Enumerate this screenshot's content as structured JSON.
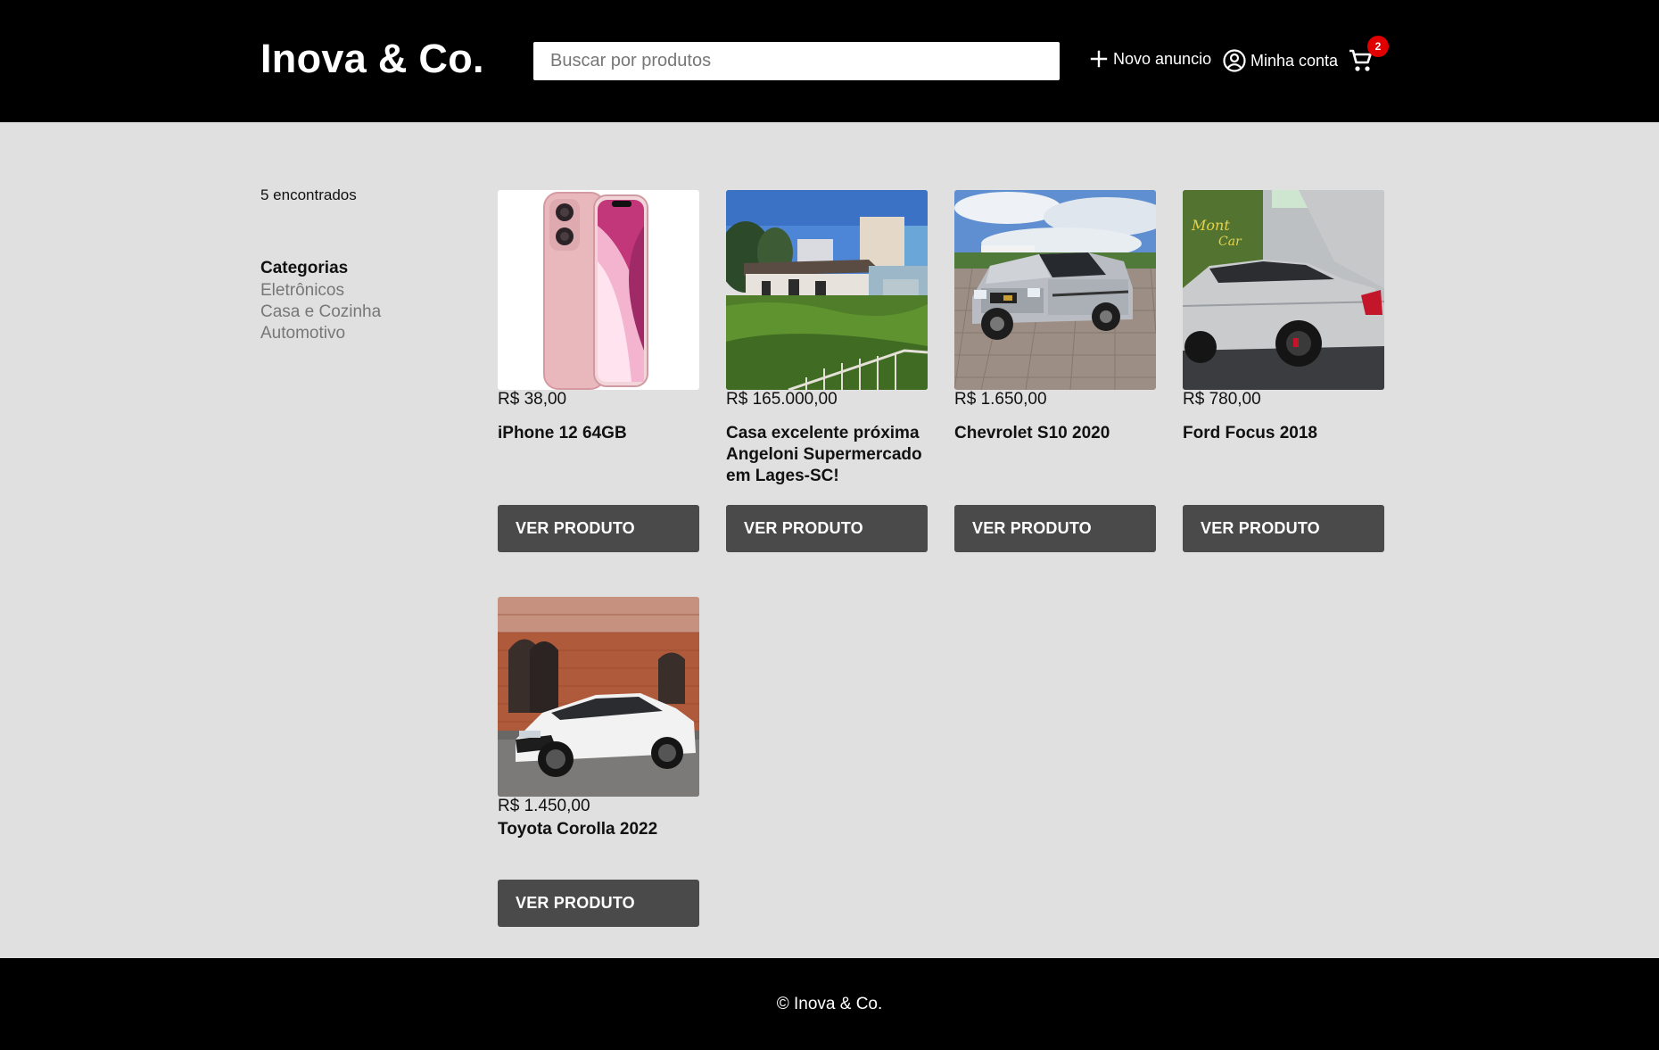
{
  "header": {
    "logo": "Inova & Co.",
    "search_placeholder": "Buscar por produtos",
    "new_listing_label": "Novo anuncio",
    "account_label": "Minha conta",
    "cart_count": "2"
  },
  "sidebar": {
    "results_count": "5 encontrados",
    "categories_title": "Categorias",
    "categories": [
      "Eletrônicos",
      "Casa e Cozinha",
      "Automotivo"
    ]
  },
  "products": [
    {
      "price": "R$ 38,00",
      "name": "iPhone 12 64GB",
      "button": "VER PRODUTO",
      "image": "pink-iphone"
    },
    {
      "price": "R$ 165.000,00",
      "name": "Casa excelente próxima Angeloni Supermercado em Lages-SC!",
      "button": "VER PRODUTO",
      "image": "house-with-grass-yard"
    },
    {
      "price": "R$ 1.650,00",
      "name": "Chevrolet S10 2020",
      "button": "VER PRODUTO",
      "image": "silver-pickup-truck"
    },
    {
      "price": "R$ 780,00",
      "name": "Ford Focus 2018",
      "button": "VER PRODUTO",
      "image": "silver-sedan-garage"
    },
    {
      "price": "R$ 1.450,00",
      "name": "Toyota Corolla 2022",
      "button": "VER PRODUTO",
      "image": "white-sedan-brick-building"
    }
  ],
  "footer": {
    "copyright": "© Inova & Co."
  },
  "colors": {
    "header_bg": "#000000",
    "page_bg": "#e0e0e0",
    "button_bg": "#4a4a4a",
    "badge_bg": "#e00000"
  }
}
